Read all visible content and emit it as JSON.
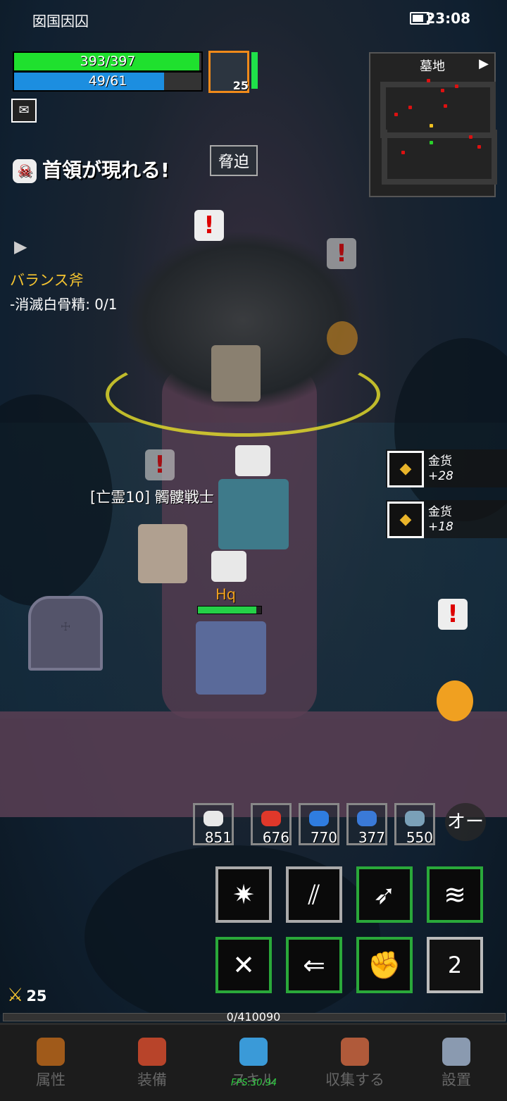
{
  "status_bar": {
    "left_icons_text": "囡国因囚",
    "time": "23:08",
    "battery_level": 0.75
  },
  "player": {
    "hp_text": "393/397",
    "hp_ratio": 0.99,
    "mp_text": "49/61",
    "mp_ratio": 0.8,
    "level": "25",
    "stamina_ratio": 1.0,
    "name": "Hq"
  },
  "minimap": {
    "title": "墓地",
    "arrow": "▶"
  },
  "alerts": {
    "boss_message": "首領が現れる!",
    "threat_label": "脅迫"
  },
  "quest": {
    "title": "バランス斧",
    "task": "-消滅白骨精: 0/1"
  },
  "target": {
    "name": "[亡霊10] 髑髏戦士"
  },
  "loot": [
    {
      "name": "金货",
      "qty": "+28"
    },
    {
      "name": "金货",
      "qty": "+18"
    }
  ],
  "potions": [
    {
      "count": "851",
      "color": "#e8e8e8"
    },
    {
      "count": "676",
      "color": "#e0382a"
    },
    {
      "count": "770",
      "color": "#2f7de0"
    },
    {
      "count": "377",
      "color": "#3a7ad8"
    },
    {
      "count": "550",
      "color": "#7aa0b8"
    }
  ],
  "auto_button": "オー",
  "skills": [
    {
      "icon": "bug-slash",
      "glyph": "✷"
    },
    {
      "icon": "triple-slash",
      "glyph": "⫽"
    },
    {
      "icon": "wing-slash",
      "glyph": "➶"
    },
    {
      "icon": "whirl",
      "glyph": "≋"
    },
    {
      "icon": "cross-swords",
      "glyph": "✕"
    },
    {
      "icon": "arrow-dash",
      "glyph": "⇐"
    },
    {
      "icon": "fist",
      "glyph": "✊"
    }
  ],
  "skill_page": "2",
  "character_level": "25",
  "xp_text": "0/410090",
  "nav": [
    {
      "label": "属性",
      "color": "#a05a1a"
    },
    {
      "label": "装備",
      "color": "#b8442a"
    },
    {
      "label": "スキル",
      "color": "#3a9ad8"
    },
    {
      "label": "収集する",
      "color": "#b05a3a"
    },
    {
      "label": "設置",
      "color": "#8a9ab0"
    }
  ],
  "fps": "FPS:30.94"
}
